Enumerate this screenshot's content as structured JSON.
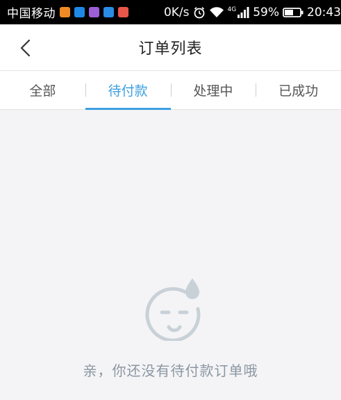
{
  "status_bar": {
    "carrier": "中国移动",
    "net_speed": "0K/s",
    "network_type": "4G",
    "battery": "59%",
    "time": "20:43",
    "notification_icons": [
      {
        "name": "app-notification-icon",
        "color": "#f08a24"
      },
      {
        "name": "app-notification-icon",
        "color": "#1e88e5"
      },
      {
        "name": "app-notification-icon",
        "color": "#9c5fd6"
      },
      {
        "name": "play-notification-icon",
        "color": "#2b8ce6"
      },
      {
        "name": "map-notification-icon",
        "color": "#e8574a"
      }
    ]
  },
  "nav": {
    "back_icon": "chevron-left-icon",
    "title": "订单列表"
  },
  "tabs": [
    {
      "label": "全部",
      "active": false
    },
    {
      "label": "待付款",
      "active": true
    },
    {
      "label": "处理中",
      "active": false
    },
    {
      "label": "已成功",
      "active": false
    }
  ],
  "empty_state": {
    "icon": "sweating-face-icon",
    "message": "亲，你还没有待付款订单哦"
  },
  "colors": {
    "accent": "#3d9fe0",
    "background": "#f4f4f6",
    "empty_icon": "#c9d1d8",
    "empty_text": "#8a96a2"
  }
}
